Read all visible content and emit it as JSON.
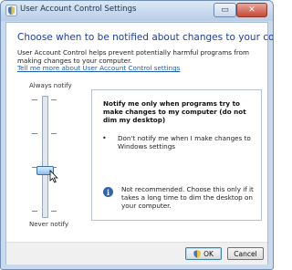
{
  "window": {
    "title": "User Account Control Settings"
  },
  "titlebar_buttons": {
    "minimize": "▭",
    "close": "✕"
  },
  "heading": "Choose when to be notified about changes to your computer",
  "description": "User Account Control helps prevent potentially harmful programs from making changes to your computer.",
  "link": "Tell me more about User Account Control settings",
  "slider": {
    "top_label": "Always notify",
    "bottom_label": "Never notify",
    "level": 1,
    "levels": 4
  },
  "panel": {
    "title": "Notify me only when programs try to make changes to my computer (do not dim my desktop)",
    "bullet": "•",
    "bullet_text": "Don't notify me when I make changes to Windows settings",
    "info_icon": "i",
    "info_text": "Not recommended. Choose this only if it takes a long time to dim the desktop on your computer."
  },
  "buttons": {
    "ok": "OK",
    "cancel": "Cancel"
  },
  "colors": {
    "heading": "#1e3f9a",
    "link": "#1c5fb8",
    "close": "#c44a36"
  }
}
